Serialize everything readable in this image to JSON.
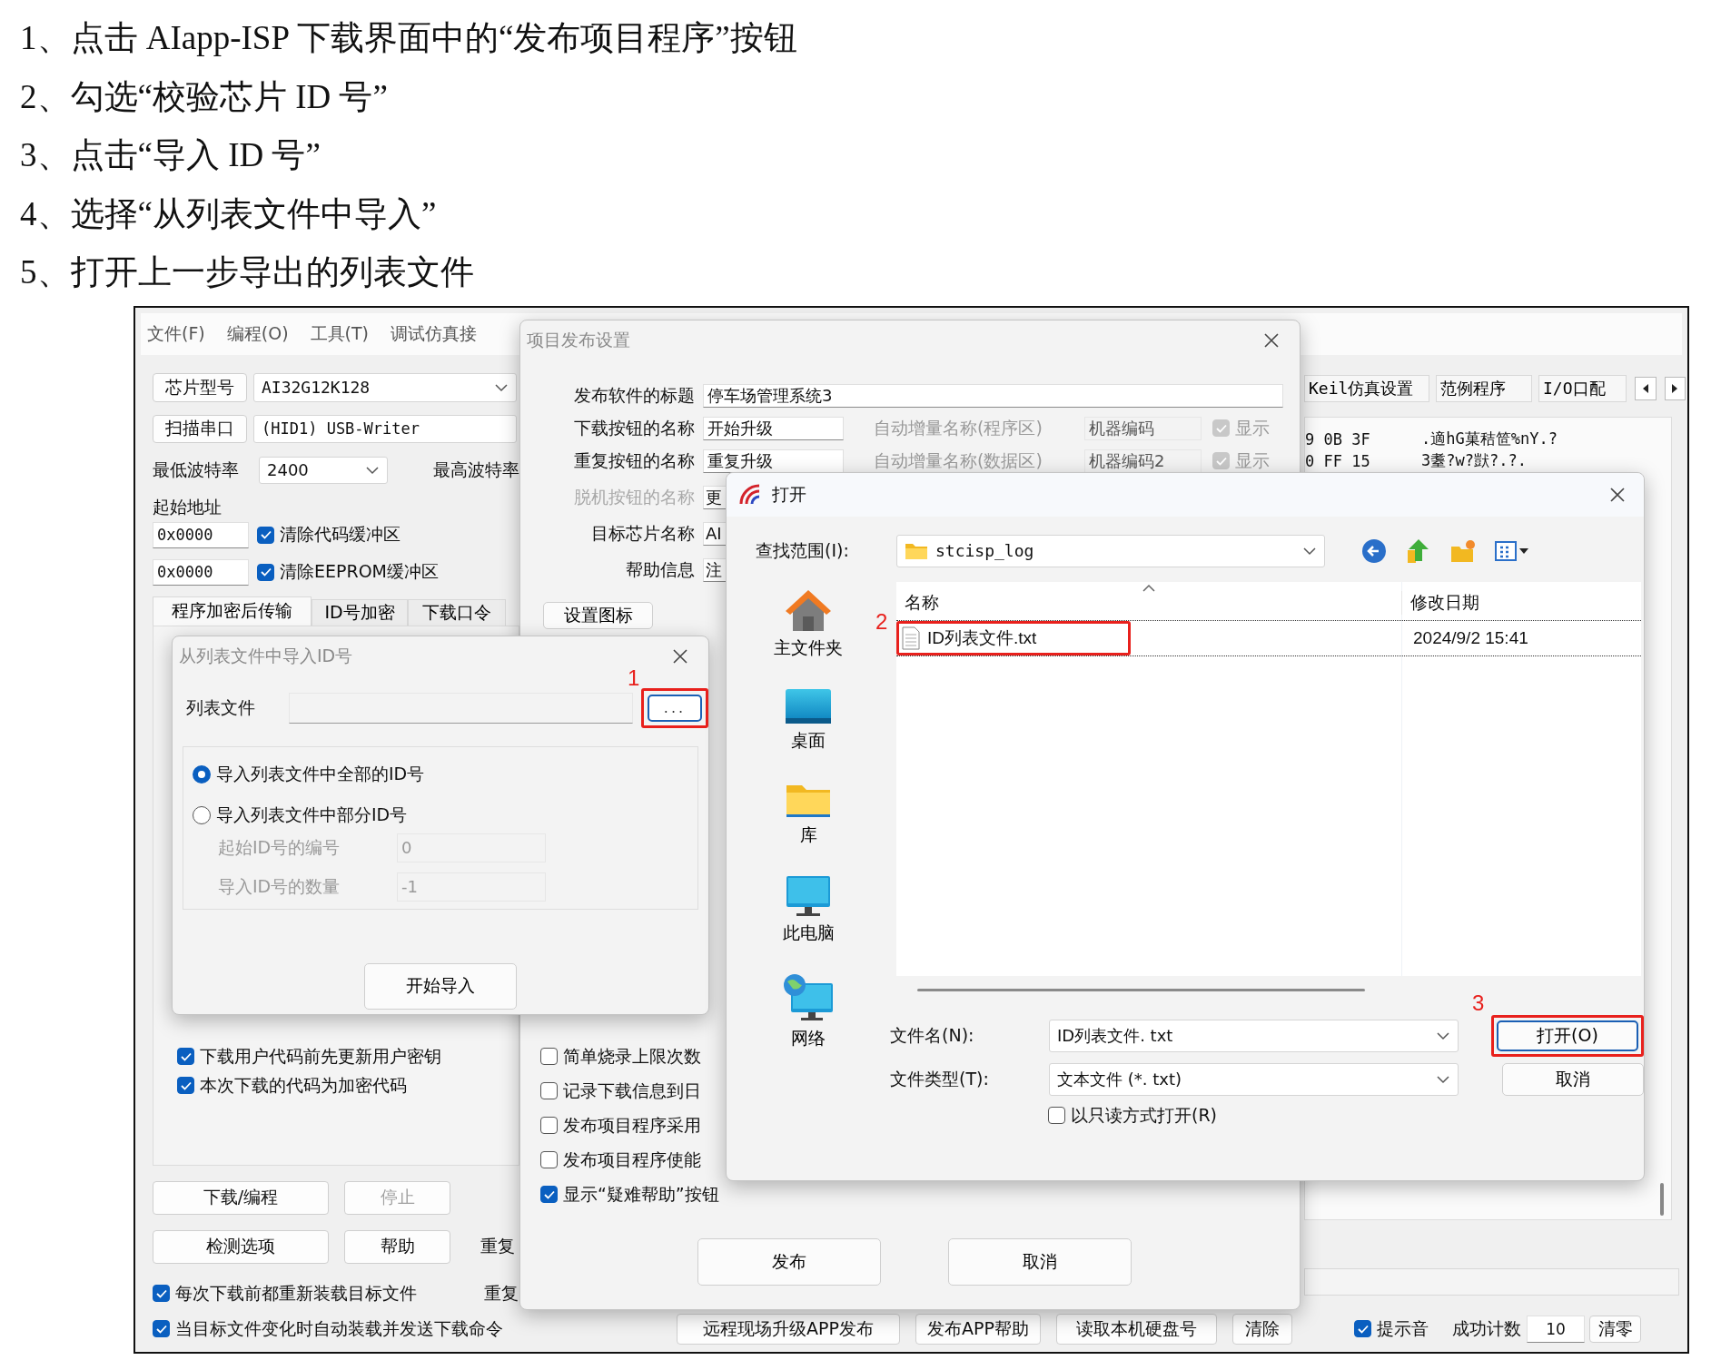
{
  "instructions": [
    "1、点击 AIapp-ISP 下载界面中的“发布项目程序”按钮",
    "2、勾选“校验芯片 ID 号”",
    "3、点击“导入 ID 号”",
    "4、选择“从列表文件中导入”",
    "5、打开上一步导出的列表文件"
  ],
  "app": {
    "menu": [
      "文件(F)",
      "编程(O)",
      "工具(T)",
      "调试仿真接"
    ],
    "chip_button": "芯片型号",
    "chip_model": "AI32G12K128",
    "scan_button": "扫描串口",
    "port": "(HID1) USB-Writer",
    "min_baud_label": "最低波特率",
    "min_baud": "2400",
    "max_baud_label": "最高波特率",
    "start_address_label": "起始地址",
    "address_rows": [
      {
        "value": "0x0000",
        "label": "清除代码缓冲区",
        "checked": true
      },
      {
        "value": "0x0000",
        "label": "清除EEPROM缓冲区",
        "checked": true
      }
    ],
    "tabs": [
      {
        "label": "程序加密后传输",
        "selected": true
      },
      {
        "label": "ID号加密",
        "selected": false
      },
      {
        "label": "下载口令",
        "selected": false
      }
    ],
    "tab_options": [
      {
        "label": "下载用户代码前先更新用户密钥",
        "checked": true
      },
      {
        "label": "本次下载的代码为加密代码",
        "checked": true
      }
    ],
    "action_buttons": [
      [
        {
          "label": "下载/编程",
          "disabled": false
        },
        {
          "label": "停止",
          "disabled": true
        }
      ],
      [
        {
          "label": "检测选项",
          "disabled": false
        },
        {
          "label": "帮助",
          "disabled": false
        }
      ]
    ],
    "repeat_labels": [
      "重复",
      "重复"
    ],
    "options": [
      {
        "label": "每次下载前都重新装载目标文件",
        "checked": true
      },
      {
        "label": "当目标文件变化时自动装载并发送下载命令",
        "checked": true
      }
    ],
    "right_tabs": [
      "Keil仿真设置",
      "范例程序",
      "I/O口配"
    ],
    "hex_rows": [
      {
        "bytes": "9 0B 3F",
        "ascii": ".適hG菓秸笸%nY.?"
      },
      {
        "bytes": "0 FF 15",
        "ascii": "3耋?w?獃?.?."
      }
    ],
    "bottom_buttons": [
      "远程现场升级APP发布",
      "发布APP帮助",
      "读取本机硬盘号",
      "清除"
    ],
    "sound": {
      "label": "提示音",
      "checked": true
    },
    "count_label": "成功计数",
    "count": "10",
    "reset_button": "清零"
  },
  "publish_dialog": {
    "title": "项目发布设置",
    "rows": [
      {
        "label": "发布软件的标题",
        "value": "停车场管理系统3",
        "disabled": false
      },
      {
        "label": "下载按钮的名称",
        "value": "开始升级",
        "disabled": false,
        "auto_label": "自动增量名称(程序区)",
        "auto_value": "机器编码",
        "show_label": "显示",
        "show_checked": true
      },
      {
        "label": "重复按钮的名称",
        "value": "重复升级",
        "disabled": false,
        "auto_label": "自动增量名称(数据区)",
        "auto_value": "机器编码2",
        "show_label": "显示",
        "show_checked": true
      },
      {
        "label": "脱机按钮的名称",
        "value": "更",
        "disabled": true
      },
      {
        "label": "目标芯片名称",
        "value": "AI",
        "disabled": false
      },
      {
        "label": "帮助信息",
        "value": "注",
        "disabled": false
      }
    ],
    "icon_button": "设置图标",
    "options": [
      {
        "label": "简单烧录上限次数",
        "checked": false
      },
      {
        "label": "记录下载信息到日",
        "checked": false
      },
      {
        "label": "发布项目程序采用",
        "checked": false
      },
      {
        "label": "发布项目程序使能",
        "checked": false
      },
      {
        "label": "显示“疑难帮助”按钮",
        "checked": true
      }
    ],
    "buttons": [
      "发布",
      "取消"
    ]
  },
  "import_dialog": {
    "title": "从列表文件中导入ID号",
    "list_file_label": "列表文件",
    "browse": {
      "label": "...",
      "callout": "1"
    },
    "radios": [
      {
        "label": "导入列表文件中全部的ID号",
        "selected": true
      },
      {
        "label": "导入列表文件中部分ID号",
        "selected": false
      }
    ],
    "range_fields": [
      {
        "label": "起始ID号的编号",
        "value": "0",
        "disabled": true
      },
      {
        "label": "导入ID号的数量",
        "value": "-1",
        "disabled": true
      }
    ],
    "import_button": "开始导入"
  },
  "open_dialog": {
    "title": "打开",
    "look_in_label": "查找范围(I):",
    "folder": "stcisp_log",
    "places": [
      {
        "label": "主文件夹",
        "kind": "home"
      },
      {
        "label": "桌面",
        "kind": "desktop"
      },
      {
        "label": "库",
        "kind": "library"
      },
      {
        "label": "此电脑",
        "kind": "computer"
      },
      {
        "label": "网络",
        "kind": "network"
      }
    ],
    "columns": [
      "名称",
      "修改日期"
    ],
    "files": [
      {
        "name": "ID列表文件.txt",
        "date": "2024/9/2 15:41",
        "selected": true,
        "callout": "2"
      }
    ],
    "filename_label": "文件名(N):",
    "filename": "ID列表文件. txt",
    "filetype_label": "文件类型(T):",
    "filetype": "文本文件 (*. txt)",
    "readonly": {
      "label": "以只读方式打开(R)",
      "checked": false
    },
    "open_button": {
      "label": "打开(O)",
      "callout": "3"
    },
    "cancel_button": "取消"
  }
}
